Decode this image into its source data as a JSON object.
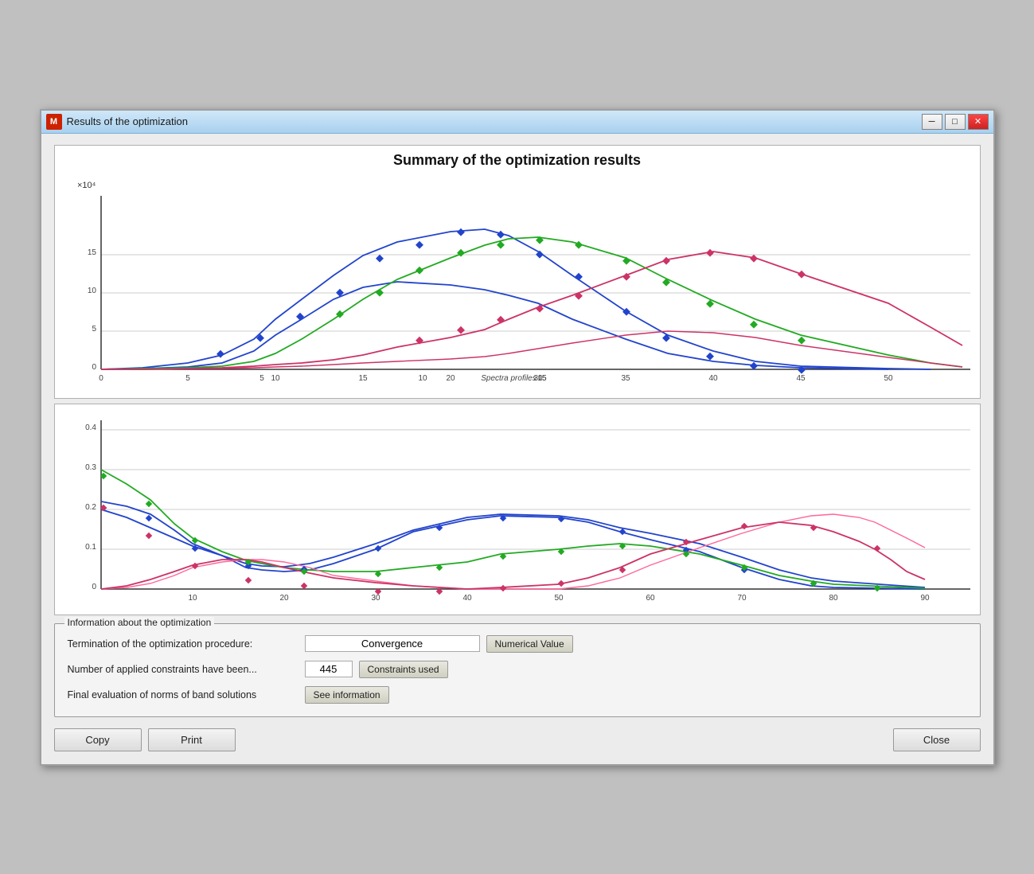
{
  "window": {
    "title": "Results of the optimization",
    "icon": "M"
  },
  "titlebar_controls": {
    "minimize": "─",
    "maximize": "□",
    "close": "✕"
  },
  "chart": {
    "title": "Summary of the optimization results",
    "top_y_label": "× 10⁴",
    "top_y_max": "15",
    "top_x_label": "Spectra profiles",
    "bottom_y_max": "0.4",
    "bottom_x_max": "90"
  },
  "info_box": {
    "legend": "Information about the optimization",
    "row1_label": "Termination of the optimization procedure:",
    "row1_value": "Convergence",
    "row1_btn": "Numerical Value",
    "row2_label": "Number of applied constraints have been...",
    "row2_value": "445",
    "row2_btn": "Constraints used",
    "row3_label": "Final evaluation of norms of band solutions",
    "row3_btn": "See information"
  },
  "buttons": {
    "copy": "Copy",
    "print": "Print",
    "close": "Close"
  }
}
